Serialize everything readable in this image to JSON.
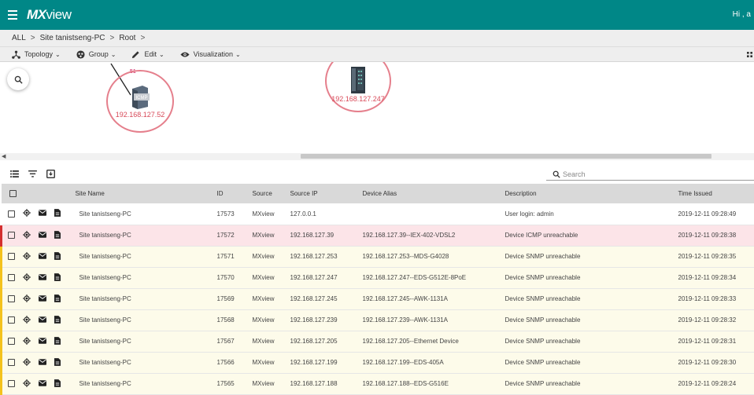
{
  "app": {
    "logo_mx": "MX",
    "logo_view": "view",
    "user_greeting": "Hi , a"
  },
  "breadcrumb": [
    "ALL",
    "Site tanistseng-PC",
    "Root"
  ],
  "toolbar": {
    "topology": "Topology",
    "group": "Group",
    "edit": "Edit",
    "visualization": "Visualization"
  },
  "topology": {
    "nodes": [
      {
        "ip": "192.168.127.52",
        "icon": "icmp-device-icon",
        "tag": "ICMP"
      },
      {
        "ip": "192.168.127.247",
        "icon": "switch-device-icon"
      }
    ],
    "link_label": ".51"
  },
  "search": {
    "placeholder": "Search"
  },
  "table": {
    "headers": {
      "site_name": "Site Name",
      "id": "ID",
      "source": "Source",
      "source_ip": "Source IP",
      "device_alias": "Device Alias",
      "description": "Description",
      "time_issued": "Time Issued"
    },
    "rows": [
      {
        "severity": "info",
        "site": "Site tanistseng-PC",
        "id": "17573",
        "source": "MXview",
        "ip": "127.0.0.1",
        "alias": "",
        "desc": "User login: admin",
        "time": "2019-12-11 09:28:49"
      },
      {
        "severity": "critical",
        "site": "Site tanistseng-PC",
        "id": "17572",
        "source": "MXview",
        "ip": "192.168.127.39",
        "alias": "192.168.127.39--IEX-402-VDSL2",
        "desc": "Device ICMP unreachable",
        "time": "2019-12-11 09:28:38"
      },
      {
        "severity": "warning",
        "site": "Site tanistseng-PC",
        "id": "17571",
        "source": "MXview",
        "ip": "192.168.127.253",
        "alias": "192.168.127.253--MDS-G4028",
        "desc": "Device SNMP unreachable",
        "time": "2019-12-11 09:28:35"
      },
      {
        "severity": "warning",
        "site": "Site tanistseng-PC",
        "id": "17570",
        "source": "MXview",
        "ip": "192.168.127.247",
        "alias": "192.168.127.247--EDS-G512E-8PoE",
        "desc": "Device SNMP unreachable",
        "time": "2019-12-11 09:28:34"
      },
      {
        "severity": "warning",
        "site": "Site tanistseng-PC",
        "id": "17569",
        "source": "MXview",
        "ip": "192.168.127.245",
        "alias": "192.168.127.245--AWK-1131A",
        "desc": "Device SNMP unreachable",
        "time": "2019-12-11 09:28:33"
      },
      {
        "severity": "warning",
        "site": "Site tanistseng-PC",
        "id": "17568",
        "source": "MXview",
        "ip": "192.168.127.239",
        "alias": "192.168.127.239--AWK-1131A",
        "desc": "Device SNMP unreachable",
        "time": "2019-12-11 09:28:32"
      },
      {
        "severity": "warning",
        "site": "Site tanistseng-PC",
        "id": "17567",
        "source": "MXview",
        "ip": "192.168.127.205",
        "alias": "192.168.127.205--Ethernet Device",
        "desc": "Device SNMP unreachable",
        "time": "2019-12-11 09:28:31"
      },
      {
        "severity": "warning",
        "site": "Site tanistseng-PC",
        "id": "17566",
        "source": "MXview",
        "ip": "192.168.127.199",
        "alias": "192.168.127.199--EDS-405A",
        "desc": "Device SNMP unreachable",
        "time": "2019-12-11 09:28:30"
      },
      {
        "severity": "warning",
        "site": "Site tanistseng-PC",
        "id": "17565",
        "source": "MXview",
        "ip": "192.168.127.188",
        "alias": "192.168.127.188--EDS-G516E",
        "desc": "Device SNMP unreachable",
        "time": "2019-12-11 09:28:24"
      }
    ]
  },
  "colors": {
    "header": "#008787",
    "critical": "#d32f2f",
    "warning": "#f4c21d",
    "node_ring": "#e57f8c"
  }
}
